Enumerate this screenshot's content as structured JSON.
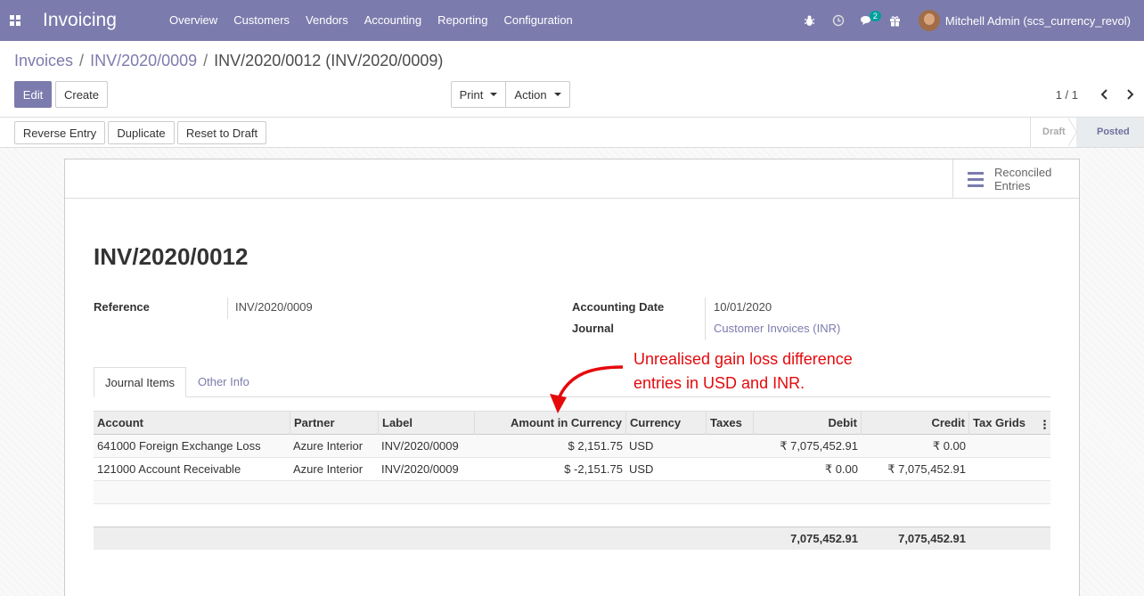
{
  "navbar": {
    "app_title": "Invoicing",
    "menu": [
      "Overview",
      "Customers",
      "Vendors",
      "Accounting",
      "Reporting",
      "Configuration"
    ],
    "message_count": "2",
    "user": "Mitchell Admin (scs_currency_revol)"
  },
  "breadcrumb": {
    "invoices": "Invoices",
    "parent": "INV/2020/0009",
    "current": "INV/2020/0012 (INV/2020/0009)"
  },
  "toolbar": {
    "edit": "Edit",
    "create": "Create",
    "print": "Print",
    "action": "Action",
    "pager": "1 / 1"
  },
  "statusbar": {
    "reverse": "Reverse Entry",
    "duplicate": "Duplicate",
    "reset": "Reset to Draft",
    "stage_draft": "Draft",
    "stage_posted": "Posted"
  },
  "smart_button": {
    "line1": "Reconciled",
    "line2": "Entries"
  },
  "form": {
    "title": "INV/2020/0012",
    "reference_label": "Reference",
    "reference_value": "INV/2020/0009",
    "date_label": "Accounting Date",
    "date_value": "10/01/2020",
    "journal_label": "Journal",
    "journal_value": "Customer Invoices (INR)"
  },
  "tabs": [
    "Journal Items",
    "Other Info"
  ],
  "table": {
    "columns": [
      "Account",
      "Partner",
      "Label",
      "Amount in Currency",
      "Currency",
      "Taxes",
      "Debit",
      "Credit",
      "Tax Grids"
    ],
    "rows": [
      [
        "641000 Foreign Exchange Loss",
        "Azure Interior",
        "INV/2020/0009",
        "$ 2,151.75",
        "USD",
        "",
        "₹ 7,075,452.91",
        "₹ 0.00",
        ""
      ],
      [
        "121000 Account Receivable",
        "Azure Interior",
        "INV/2020/0009",
        "$ -2,151.75",
        "USD",
        "",
        "₹ 0.00",
        "₹ 7,075,452.91",
        ""
      ]
    ],
    "total_debit": "7,075,452.91",
    "total_credit": "7,075,452.91"
  },
  "annotation": {
    "line1": "Unrealised gain loss difference",
    "line2": "entries in USD and INR.",
    "color": "#e5090c"
  },
  "colors": {
    "brand": "#7c7bad",
    "annotation": "#e5090c"
  }
}
